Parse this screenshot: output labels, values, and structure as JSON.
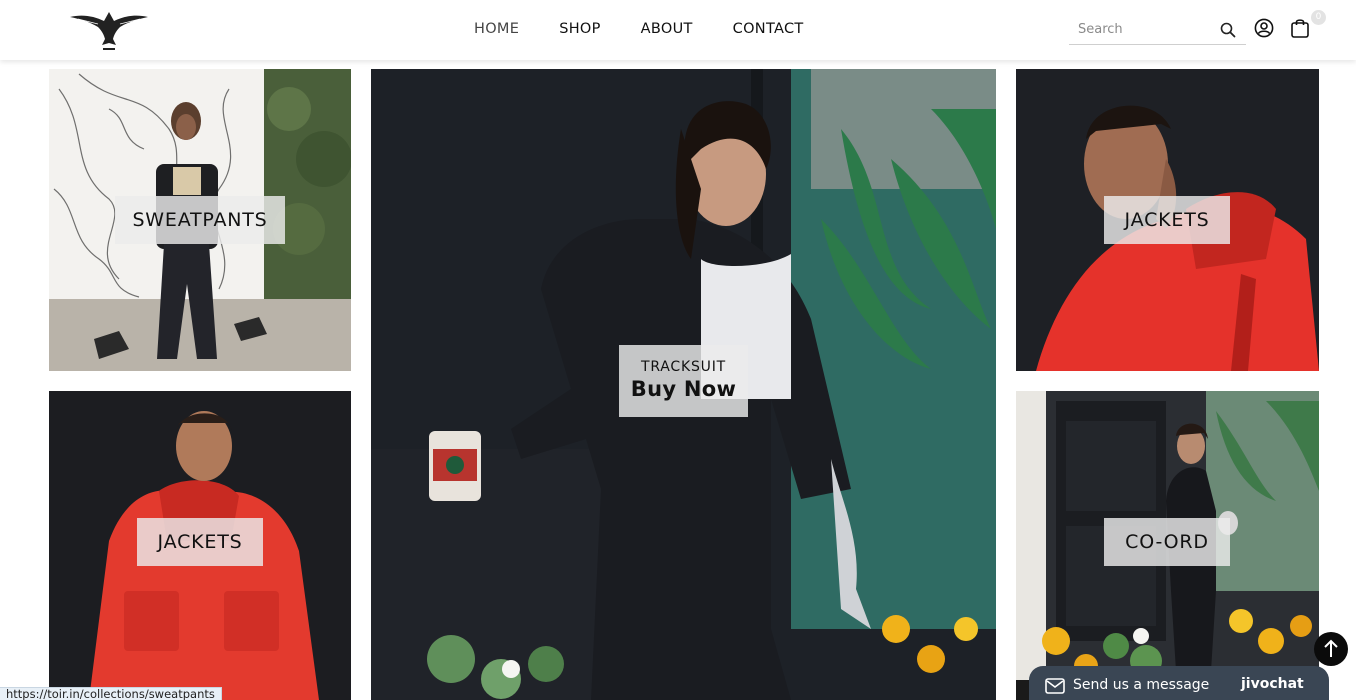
{
  "header": {
    "logo_alt": "Toir eagle logo",
    "nav": [
      {
        "label": "HOME"
      },
      {
        "label": "SHOP"
      },
      {
        "label": "ABOUT"
      },
      {
        "label": "CONTACT"
      }
    ],
    "search": {
      "placeholder": "Search",
      "value": ""
    },
    "cart_count": "0",
    "icons": {
      "search": "search-icon",
      "account": "user-circle-icon",
      "cart": "shopping-bag-icon"
    }
  },
  "tiles": {
    "sweatpants": {
      "label": "SWEATPANTS"
    },
    "jackets_left": {
      "label": "JACKETS"
    },
    "tracksuit": {
      "label": "TRACKSUIT",
      "cta": "Buy Now"
    },
    "jackets_right": {
      "label": "JACKETS"
    },
    "coord": {
      "label": "CO-ORD"
    }
  },
  "chat": {
    "label": "Send us a message",
    "brand": "jivochat"
  },
  "status_url": "https://toir.in/collections/sweatpants",
  "colors": {
    "jacket_red": "#e5322b",
    "dark_bg": "#1e1f24",
    "label_bg": "#ebebeb",
    "chat_bg": "#3a4654"
  }
}
